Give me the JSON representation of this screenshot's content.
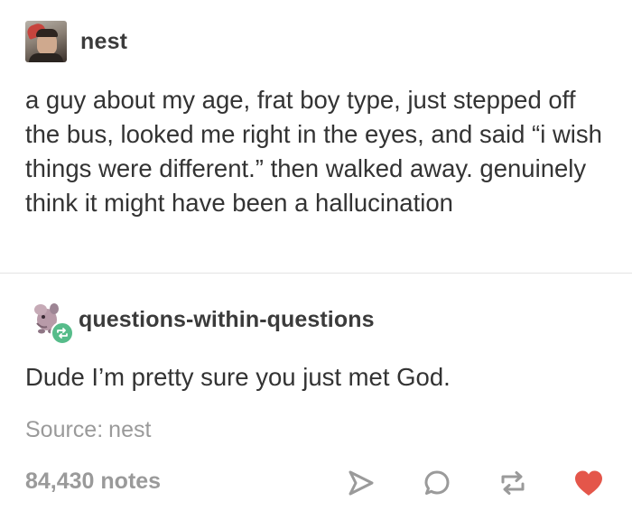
{
  "post": {
    "author": "nest",
    "text": "a guy about my age, frat boy type, just stepped off the bus, looked me right in the eyes, and said “i wish things were different.” then walked away. genuinely think it might have been a hallucination"
  },
  "reblog": {
    "author": "questions-within-questions",
    "text": "Dude I’m pretty sure you just met God."
  },
  "source": {
    "prefix": "Source:",
    "name": "nest"
  },
  "footer": {
    "notes": "84,430 notes",
    "actions": [
      "share-icon",
      "reply-icon",
      "reblog-icon",
      "like-icon"
    ]
  },
  "colors": {
    "text": "#333333",
    "muted": "#9a9a9a",
    "reblog_badge": "#56bc8a",
    "like": "#e4564a",
    "divider": "#e4e4e4"
  }
}
